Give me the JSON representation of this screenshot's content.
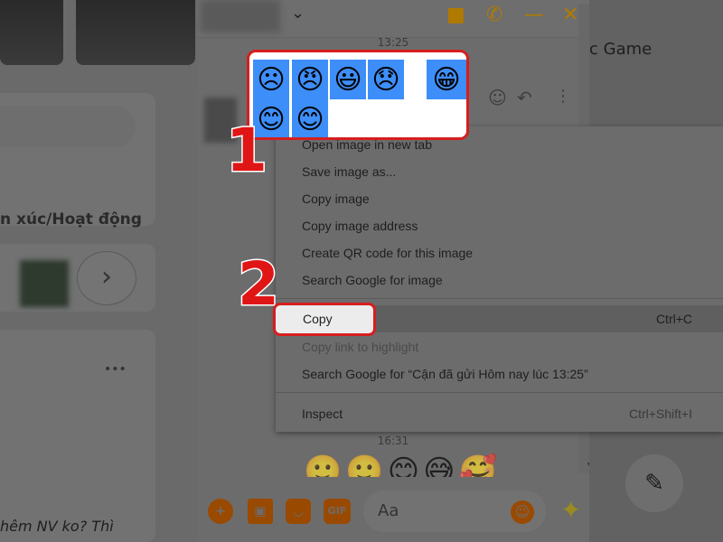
{
  "left_panel": {
    "feeling_text": "n xúc/Hoạt động",
    "post_snippet": "hêm NV ko? Thì",
    "more_label": "•••",
    "next_label": "›"
  },
  "chat": {
    "header_chevron": "⌄",
    "time_1": "13:25",
    "time_2": "16:31",
    "input_placeholder": "Aa",
    "gif_label": "GIF",
    "icons": [
      "video-call-icon",
      "phone-icon",
      "minimize-icon",
      "close-icon",
      "plus-icon",
      "image-icon",
      "sticker-icon",
      "gif-icon",
      "emoji-icon",
      "sparkle-icon"
    ]
  },
  "right_panel": {
    "text": "c Game"
  },
  "selected_image": {
    "emojis": [
      "☹",
      "😠",
      "😃",
      "😞",
      "😁",
      "😊",
      "😊"
    ],
    "tile_color": "#3d8ef8"
  },
  "message_emojis": [
    "🙂",
    "🙂",
    "😊",
    "😅",
    "🥰"
  ],
  "context_menu": {
    "items": [
      {
        "label": "Open image in new tab"
      },
      {
        "label": "Save image as..."
      },
      {
        "label": "Copy image"
      },
      {
        "label": "Copy image address"
      },
      {
        "label": "Create QR code for this image"
      },
      {
        "label": "Search Google for image"
      },
      {
        "label": "Copy",
        "shortcut": "Ctrl+C"
      },
      {
        "label": "Copy link to highlight"
      },
      {
        "label": "Search Google for “Cận đã gửi Hôm nay lúc 13:25”"
      },
      {
        "label": "Inspect",
        "shortcut": "Ctrl+Shift+I"
      }
    ]
  },
  "annotations": {
    "step1": "1",
    "step2": "2",
    "highlight_color": "#d61e1e"
  }
}
